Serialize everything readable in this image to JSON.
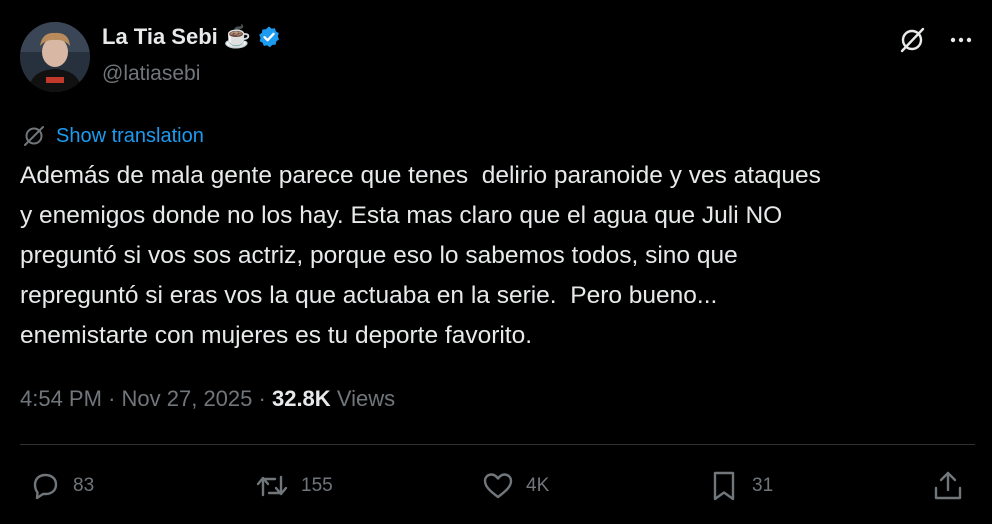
{
  "author": {
    "display_name": "La Tia Sebi",
    "emoji": "☕",
    "handle": "@latiasebi",
    "verified": true,
    "badge_color": "#1d9bf0"
  },
  "translate": {
    "label": "Show translation"
  },
  "post": {
    "text": "Además de mala gente parece que tenes  delirio paranoide y ves ataques\ny enemigos donde no los hay. Esta mas claro que el agua que Juli NO\npreguntó si vos sos actriz, porque eso lo sabemos todos, sino que\nrepreguntó si eras vos la que actuaba en la serie.  Pero bueno...\nenemistarte con mujeres es tu deporte favorito."
  },
  "meta": {
    "time": "4:54 PM",
    "separator": "·",
    "date": "Nov 27, 2025",
    "views_count": "32.8K",
    "views_label": "Views"
  },
  "actions": {
    "reply_count": "83",
    "repost_count": "155",
    "like_count": "4K",
    "bookmark_count": "31"
  },
  "icons": {
    "grok": "grok-icon",
    "more": "more-icon",
    "translate": "translate-icon",
    "reply": "reply-icon",
    "repost": "repost-icon",
    "like": "heart-icon",
    "bookmark": "bookmark-icon",
    "share": "share-icon"
  },
  "colors": {
    "background": "#000000",
    "text": "#e7e9ea",
    "muted": "#71767b",
    "link": "#1d9bf0",
    "divider": "#2f3336"
  }
}
